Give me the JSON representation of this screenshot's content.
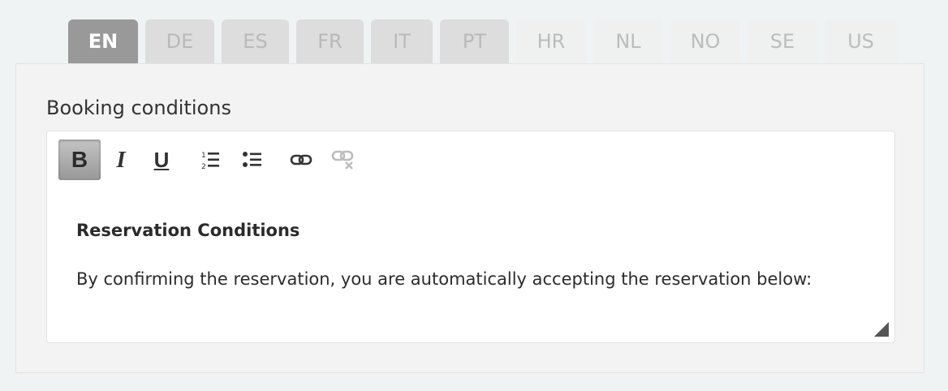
{
  "language_tabs": [
    {
      "code": "EN",
      "state": "active"
    },
    {
      "code": "DE",
      "state": "enabled"
    },
    {
      "code": "ES",
      "state": "enabled"
    },
    {
      "code": "FR",
      "state": "enabled"
    },
    {
      "code": "IT",
      "state": "enabled"
    },
    {
      "code": "PT",
      "state": "enabled"
    },
    {
      "code": "HR",
      "state": "disabled"
    },
    {
      "code": "NL",
      "state": "disabled"
    },
    {
      "code": "NO",
      "state": "disabled"
    },
    {
      "code": "SE",
      "state": "disabled"
    },
    {
      "code": "US",
      "state": "disabled"
    }
  ],
  "field": {
    "label": "Booking conditions"
  },
  "toolbar": {
    "bold_label": "B",
    "italic_label": "I",
    "underline_label": "U",
    "icons": [
      "ordered-list-icon",
      "unordered-list-icon",
      "link-icon",
      "unlink-icon"
    ]
  },
  "editor": {
    "heading": "Reservation Conditions",
    "body": "By confirming the reservation, you are automatically accepting the reservation below:"
  },
  "colors": {
    "active_tab": "#999999",
    "inactive_tab": "#dddddd",
    "disabled_tab": "#eff1f1",
    "page_background": "#eff3f3",
    "panel_background": "#f3f3f3"
  }
}
